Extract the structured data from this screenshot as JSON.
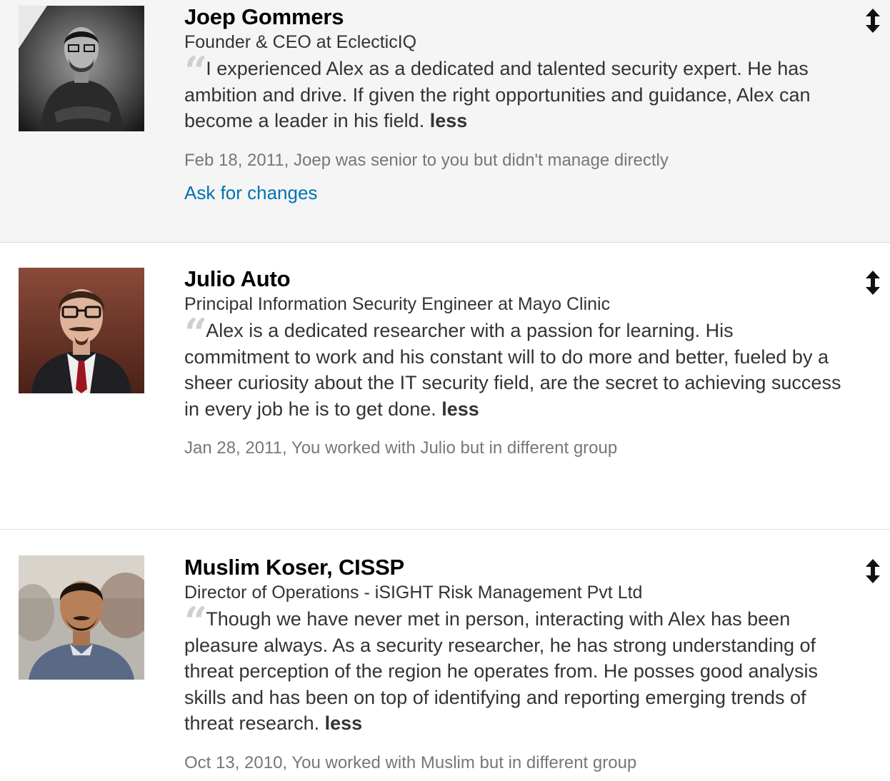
{
  "recommendations": [
    {
      "name": "Joep Gommers",
      "headline": "Founder & CEO at EclecticIQ",
      "quote_mark": "“",
      "text": "I experienced Alex as a dedicated and talented security expert. He has ambition and drive. If given the right opportunities and guidance, Alex can become a leader in his field.",
      "less_label": "less",
      "meta": "Feb 18, 2011, Joep was senior to you but didn't manage directly",
      "action_label": "Ask for changes",
      "reorder_icon": "up-down-arrow-icon"
    },
    {
      "name": "Julio Auto",
      "headline": "Principal Information Security Engineer at Mayo Clinic",
      "quote_mark": "“",
      "text": "Alex is a dedicated researcher with a passion for learning. His commitment to work and his constant will to do more and better, fueled by a sheer curiosity about the IT security field, are the secret to achieving success in every job he is to get done.",
      "less_label": "less",
      "meta": "Jan 28, 2011, You worked with Julio but in different group",
      "reorder_icon": "up-down-arrow-icon"
    },
    {
      "name": "Muslim Koser, CISSP",
      "headline": "Director of Operations - iSIGHT Risk Management Pvt Ltd",
      "quote_mark": "“",
      "text": "Though we have never met in person, interacting with Alex has been pleasure always. As a security researcher, he has strong understanding of threat perception of the region he operates from. He posses good analysis skills and has been on top of identifying and reporting emerging trends of threat research.",
      "less_label": "less",
      "meta": "Oct 13, 2010, You worked with Muslim but in different group",
      "reorder_icon": "up-down-arrow-icon"
    }
  ],
  "colors": {
    "link": "#0073b1",
    "highlight_bg": "#f5f5f5",
    "meta_text": "#777777",
    "quote_mark": "#cfcfcf"
  }
}
